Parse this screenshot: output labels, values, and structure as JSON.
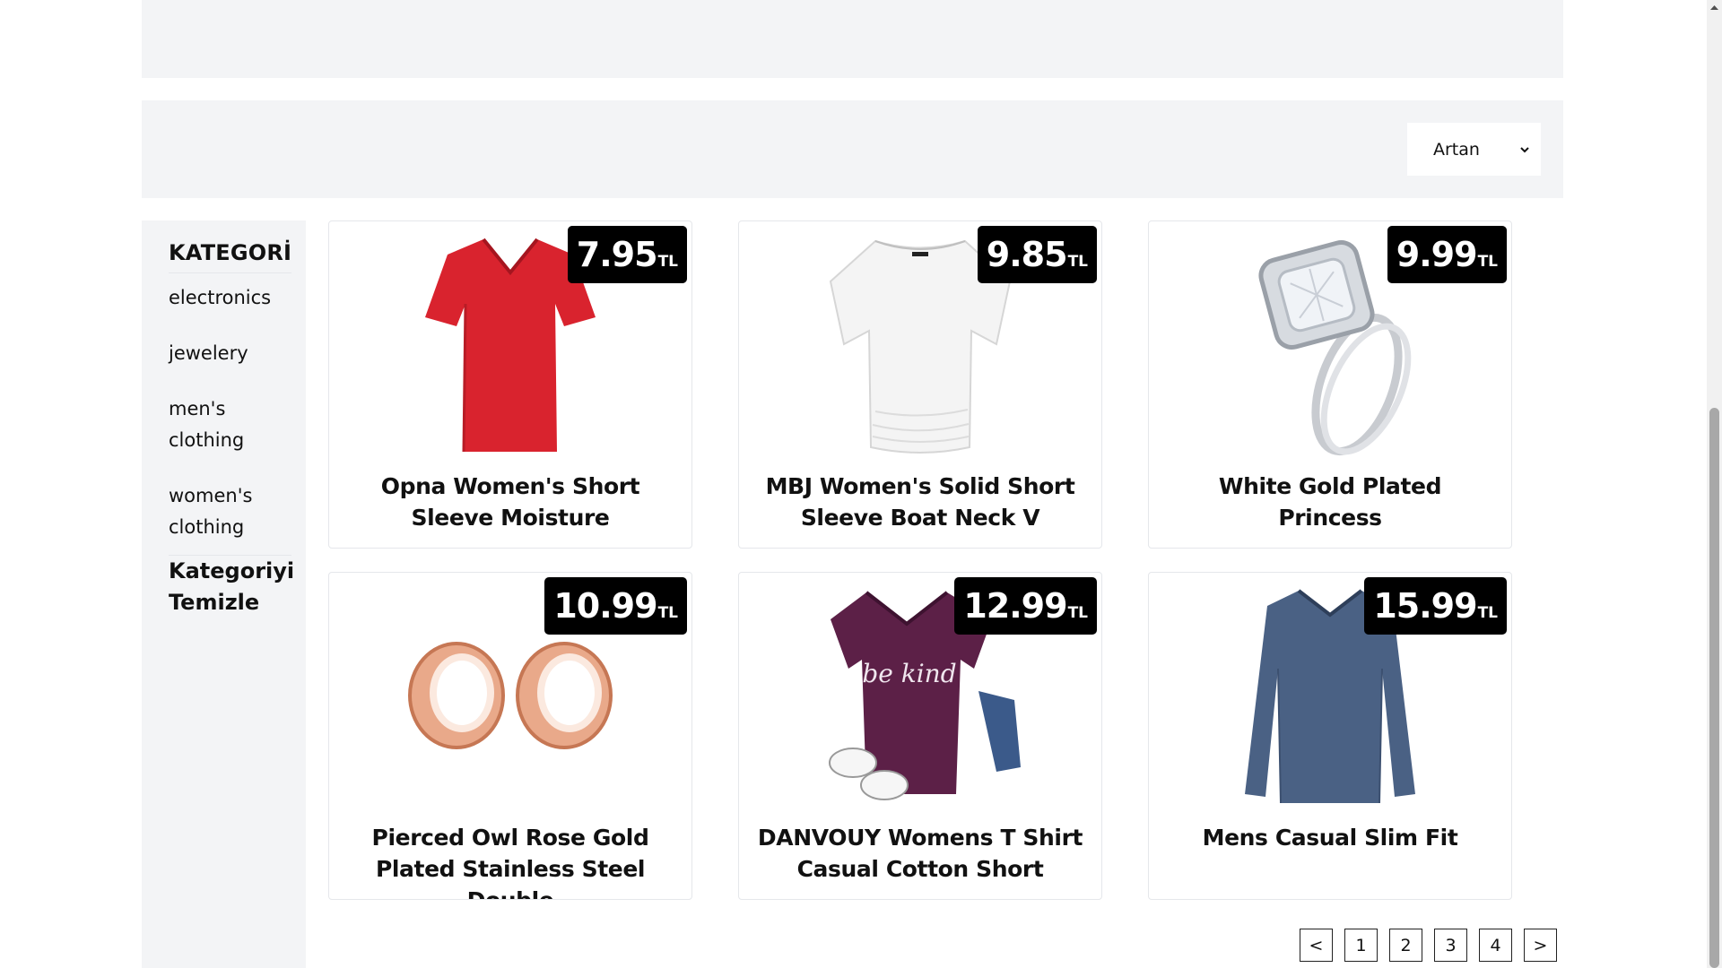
{
  "sort": {
    "value": "Artan"
  },
  "sidebar": {
    "title": "KATEGORİ",
    "categories": [
      {
        "label": "electronics"
      },
      {
        "label": "jewelery"
      },
      {
        "label": "men's clothing"
      },
      {
        "label": "women's clothing"
      }
    ],
    "clear_label": "Kategoriyi Temizle"
  },
  "currency": "TL",
  "products": [
    {
      "name": "Opna Women's Short Sleeve Moisture",
      "price": "7.95",
      "image": "red-vneck-tshirt"
    },
    {
      "name": "MBJ Women's Solid Short Sleeve Boat Neck V",
      "price": "9.85",
      "image": "white-boatneck-top"
    },
    {
      "name": "White Gold Plated Princess",
      "price": "9.99",
      "image": "diamond-ring-set"
    },
    {
      "name": "Pierced Owl Rose Gold Plated Stainless Steel Double",
      "price": "10.99",
      "image": "rose-gold-ear-plugs"
    },
    {
      "name": "DANVOUY Womens T Shirt Casual Cotton Short",
      "price": "12.99",
      "image": "purple-be-kind-tshirt",
      "print_text": "be kind"
    },
    {
      "name": "Mens Casual Slim Fit",
      "price": "15.99",
      "image": "navy-long-sleeve-shirt"
    }
  ],
  "pagination": {
    "prev": "<",
    "pages": [
      "1",
      "2",
      "3",
      "4"
    ],
    "next": ">"
  },
  "colors": {
    "panel_bg": "#f3f4f6",
    "price_bg": "#000000",
    "card_border": "#e5e7eb"
  }
}
